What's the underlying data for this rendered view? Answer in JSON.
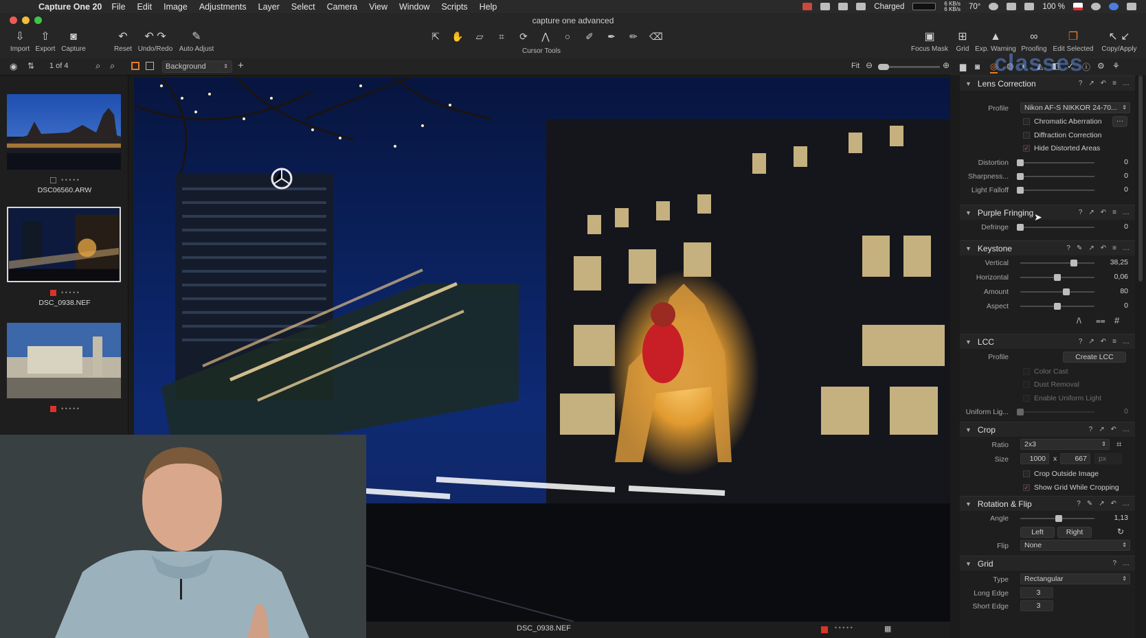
{
  "menubar": {
    "apple": "",
    "app_name": "Capture One 20",
    "items": [
      "File",
      "Edit",
      "Image",
      "Adjustments",
      "Layer",
      "Select",
      "Camera",
      "View",
      "Window",
      "Scripts",
      "Help"
    ],
    "battery_status": "Charged",
    "network_up": "6 KB/s",
    "network_down": "6 KB/s",
    "temperature": "70°",
    "battery_percent": "100 %"
  },
  "window": {
    "title": "capture one advanced"
  },
  "toolbar": {
    "left": [
      "Import",
      "Export",
      "Capture",
      "Reset",
      "Undo/Redo",
      "Auto Adjust"
    ],
    "cursor_tools_label": "Cursor Tools",
    "right": [
      "Focus Mask",
      "Grid",
      "Exp. Warning",
      "Proofing",
      "Edit Selected",
      "Copy/Apply"
    ]
  },
  "subbar": {
    "count": "1 of 4",
    "layer_select": "Background",
    "fit": "Fit"
  },
  "browser": {
    "thumbnails": [
      {
        "name": "DSC06560.ARW",
        "selected": false,
        "tag": "none"
      },
      {
        "name": "DSC_0938.NEF",
        "selected": true,
        "tag": "red"
      },
      {
        "name": "",
        "selected": false,
        "tag": "red"
      }
    ]
  },
  "viewer": {
    "filename": "DSC_0938.NEF"
  },
  "panel": {
    "lens": {
      "title": "Lens Correction",
      "profile_label": "Profile",
      "profile_value": "Nikon AF-S NIKKOR 24-70...",
      "checks": [
        {
          "label": "Chromatic Aberration",
          "checked": false
        },
        {
          "label": "Diffraction Correction",
          "checked": false
        },
        {
          "label": "Hide Distorted Areas",
          "checked": true
        }
      ],
      "sliders": [
        {
          "label": "Distortion",
          "value": "0",
          "pos": 0
        },
        {
          "label": "Sharpness...",
          "value": "0",
          "pos": 0
        },
        {
          "label": "Light Falloff",
          "value": "0",
          "pos": 0
        }
      ]
    },
    "fringe": {
      "title": "Purple Fringing",
      "sliders": [
        {
          "label": "Defringe",
          "value": "0",
          "pos": 0
        }
      ]
    },
    "keystone": {
      "title": "Keystone",
      "sliders": [
        {
          "label": "Vertical",
          "value": "38,25",
          "pos": 0.72
        },
        {
          "label": "Horizontal",
          "value": "0,06",
          "pos": 0.5
        },
        {
          "label": "Amount",
          "value": "80",
          "pos": 0.62
        },
        {
          "label": "Aspect",
          "value": "0",
          "pos": 0.5
        }
      ]
    },
    "lcc": {
      "title": "LCC",
      "profile_label": "Profile",
      "create_button": "Create LCC",
      "checks": [
        {
          "label": "Color Cast",
          "checked": false
        },
        {
          "label": "Dust Removal",
          "checked": false
        },
        {
          "label": "Enable Uniform Light",
          "checked": false
        }
      ],
      "uniform_label": "Uniform Lig...",
      "uniform_value": "0"
    },
    "crop": {
      "title": "Crop",
      "ratio_label": "Ratio",
      "ratio_value": "2x3",
      "size_label": "Size",
      "width": "1000",
      "x": "x",
      "height": "667",
      "unit": "px",
      "checks": [
        {
          "label": "Crop Outside Image",
          "checked": false
        },
        {
          "label": "Show Grid While Cropping",
          "checked": true
        }
      ]
    },
    "rotation": {
      "title": "Rotation & Flip",
      "angle_label": "Angle",
      "angle_value": "1,13",
      "angle_pos": 0.52,
      "left": "Left",
      "right": "Right",
      "flip_label": "Flip",
      "flip_value": "None"
    },
    "grid": {
      "title": "Grid",
      "type_label": "Type",
      "type_value": "Rectangular",
      "long_label": "Long Edge",
      "long_value": "3",
      "short_label": "Short Edge",
      "short_value": "3"
    }
  },
  "watermark": "classes",
  "colors": {
    "accent": "#e87a2a",
    "red_tag": "#d9342b",
    "check": "#e24a3a"
  }
}
